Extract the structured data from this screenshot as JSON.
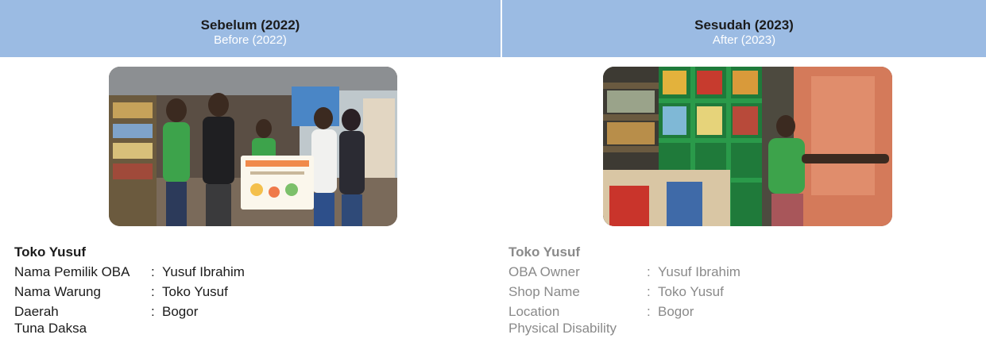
{
  "header": {
    "before_title": "Sebelum (2022)",
    "before_subtitle": "Before (2022)",
    "after_title": "Sesudah (2023)",
    "after_subtitle": "After (2023)"
  },
  "left": {
    "shop_title": "Toko Yusuf",
    "rows": [
      {
        "label": "Nama Pemilik OBA",
        "value": "Yusuf Ibrahim"
      },
      {
        "label": "Nama Warung",
        "value": "Toko Yusuf"
      },
      {
        "label": "Daerah",
        "value": "Bogor"
      }
    ],
    "note": "Tuna Daksa"
  },
  "right": {
    "shop_title": "Toko Yusuf",
    "rows": [
      {
        "label": "OBA Owner",
        "value": "Yusuf Ibrahim"
      },
      {
        "label": "Shop Name",
        "value": "Toko Yusuf"
      },
      {
        "label": "Location",
        "value": "Bogor"
      }
    ],
    "note": "Physical Disability"
  },
  "colon": ":",
  "colors": {
    "header_bg": "#9bbbe3",
    "header_subtitle": "#ffffff",
    "left_text": "#1b1b1b",
    "right_text": "#8a8a8a"
  }
}
